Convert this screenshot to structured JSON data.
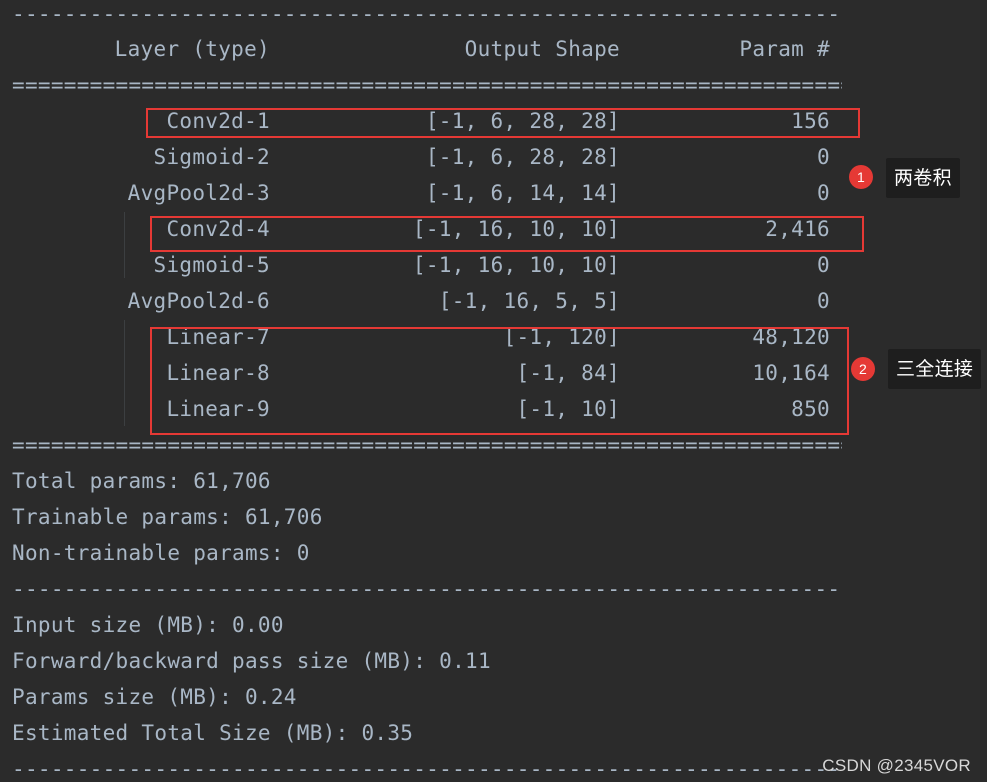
{
  "rule_dash": "-----------------------------------------------------------------------------------------------",
  "rule_equal": "===============================================================================================",
  "header": {
    "layer": "Layer (type)",
    "shape": "Output Shape",
    "param": "Param #"
  },
  "rows": [
    {
      "layer": "Conv2d-1",
      "shape": "[-1, 6, 28, 28]",
      "param": "156"
    },
    {
      "layer": "Sigmoid-2",
      "shape": "[-1, 6, 28, 28]",
      "param": "0"
    },
    {
      "layer": "AvgPool2d-3",
      "shape": "[-1, 6, 14, 14]",
      "param": "0"
    },
    {
      "layer": "Conv2d-4",
      "shape": "[-1, 16, 10, 10]",
      "param": "2,416"
    },
    {
      "layer": "Sigmoid-5",
      "shape": "[-1, 16, 10, 10]",
      "param": "0"
    },
    {
      "layer": "AvgPool2d-6",
      "shape": "[-1, 16, 5, 5]",
      "param": "0"
    },
    {
      "layer": "Linear-7",
      "shape": "[-1, 120]",
      "param": "48,120"
    },
    {
      "layer": "Linear-8",
      "shape": "[-1, 84]",
      "param": "10,164"
    },
    {
      "layer": "Linear-9",
      "shape": "[-1, 10]",
      "param": "850"
    }
  ],
  "totals": {
    "total": "Total params: 61,706",
    "trainable": "Trainable params: 61,706",
    "non_trainable": "Non-trainable params: 0"
  },
  "sizes": {
    "input": "Input size (MB): 0.00",
    "pass": "Forward/backward pass size (MB): 0.11",
    "params": "Params size (MB): 0.24",
    "total": "Estimated Total Size (MB): 0.35"
  },
  "annotations": [
    {
      "number": "1",
      "label": "两卷积"
    },
    {
      "number": "2",
      "label": "三全连接"
    }
  ],
  "highlight_color": "#e53935",
  "watermark": "CSDN @2345VOR"
}
